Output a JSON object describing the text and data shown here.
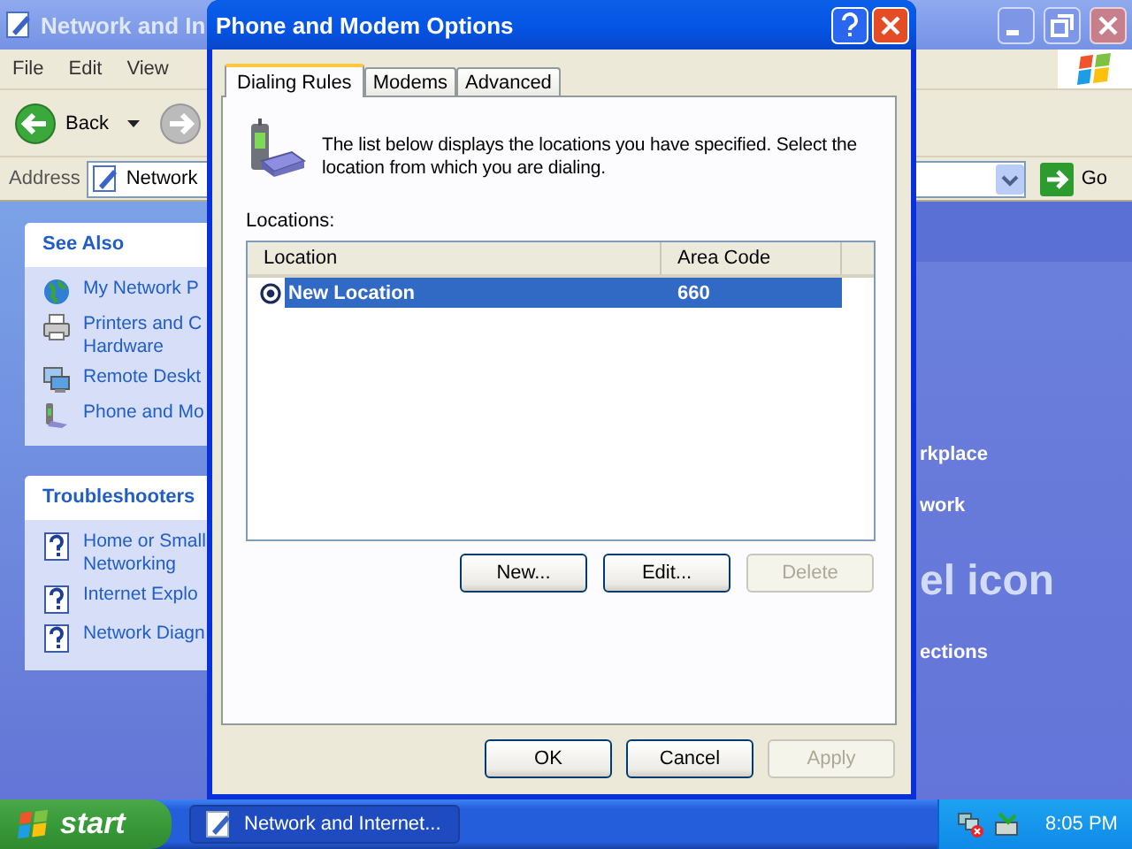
{
  "explorer": {
    "title": "Network and In",
    "menu": [
      "File",
      "Edit",
      "View"
    ],
    "back": "Back",
    "address_label": "Address",
    "address_value": "Network",
    "go": "Go",
    "panels": [
      {
        "title": "See Also",
        "items": [
          {
            "kind": "globe",
            "lines": [
              "My Network P"
            ]
          },
          {
            "kind": "printer",
            "lines": [
              "Printers and C",
              "Hardware"
            ]
          },
          {
            "kind": "remote",
            "lines": [
              "Remote Deskt"
            ]
          },
          {
            "kind": "phone",
            "lines": [
              "Phone and Mo"
            ]
          }
        ]
      },
      {
        "title": "Troubleshooters",
        "items": [
          {
            "kind": "help",
            "lines": [
              "Home or Small",
              "Networking"
            ]
          },
          {
            "kind": "help",
            "lines": [
              "Internet Explo"
            ]
          },
          {
            "kind": "help",
            "lines": [
              "Network Diagn"
            ]
          }
        ]
      }
    ],
    "fragments": [
      {
        "kind": "link",
        "text": "rkplace"
      },
      {
        "kind": "link",
        "text": "work"
      },
      {
        "kind": "heading",
        "text": "el icon"
      },
      {
        "kind": "link",
        "text": "ections"
      }
    ]
  },
  "dialog": {
    "title": "Phone and Modem Options",
    "tabs": [
      {
        "label": "Dialing Rules",
        "selected": true
      },
      {
        "label": "Modems",
        "selected": false
      },
      {
        "label": "Advanced",
        "selected": false
      }
    ],
    "description": "The list below displays the locations you have specified. Select the location from which you are dialing.",
    "locations_label": "Locations:",
    "columns": [
      "Location",
      "Area Code"
    ],
    "rows": [
      {
        "location": "New Location",
        "area_code": "660",
        "selected": true
      }
    ],
    "list_buttons": [
      {
        "label": "New...",
        "disabled": false
      },
      {
        "label": "Edit...",
        "disabled": false
      },
      {
        "label": "Delete",
        "disabled": true
      }
    ],
    "footer_buttons": [
      {
        "label": "OK",
        "disabled": false
      },
      {
        "label": "Cancel",
        "disabled": false
      },
      {
        "label": "Apply",
        "disabled": true
      }
    ]
  },
  "taskbar": {
    "start": "start",
    "tasks": [
      {
        "label": "Network and Internet..."
      }
    ],
    "clock": "8:05 PM"
  }
}
